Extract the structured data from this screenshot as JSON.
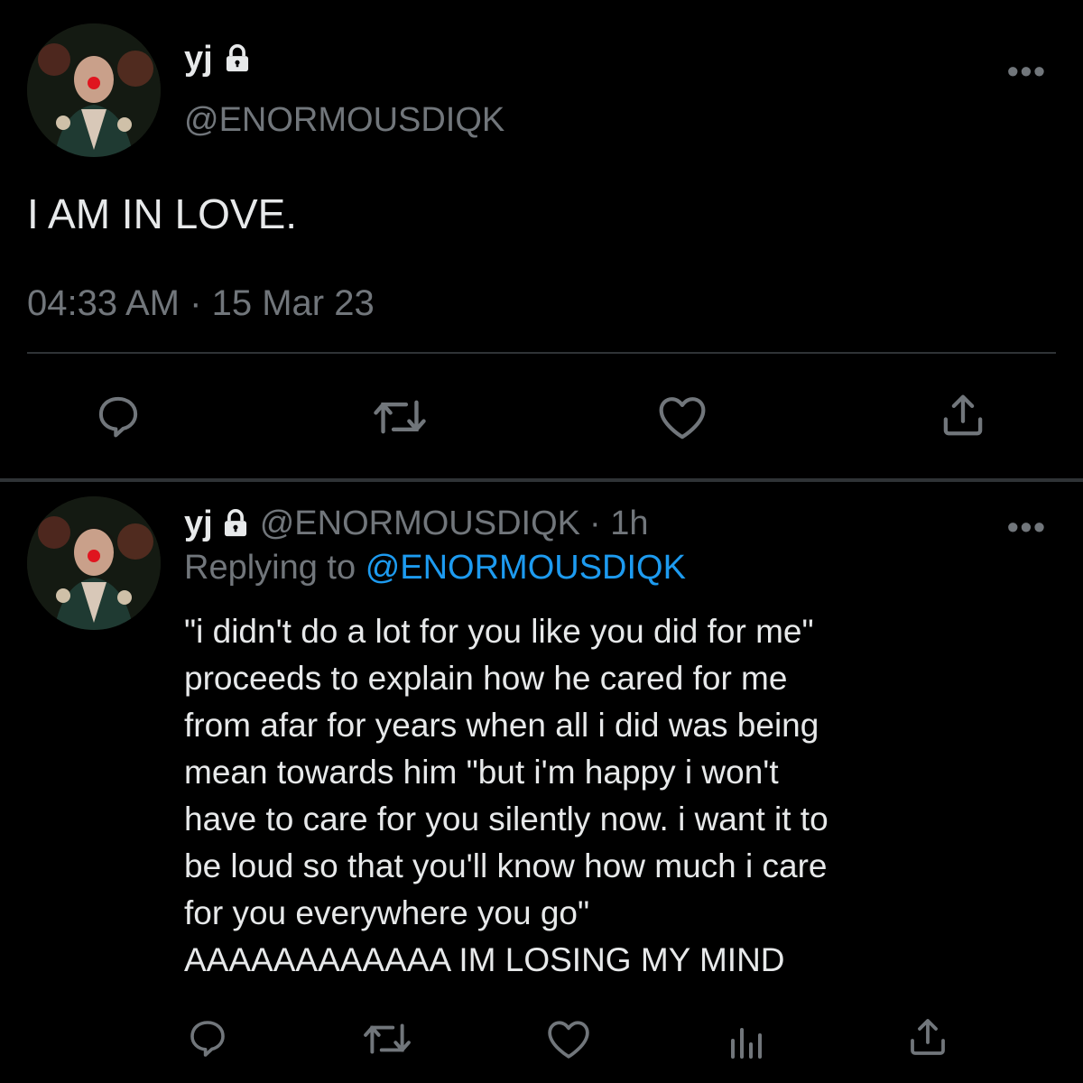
{
  "tweet": {
    "author_name": "yj",
    "handle": "@ENORMOUSDIQK",
    "text": "I AM IN LOVE.",
    "time": "04:33 AM",
    "separator": "·",
    "date": "15 Mar 23",
    "more": "•••",
    "icons": [
      "reply-icon",
      "retweet-icon",
      "like-icon",
      "share-icon"
    ]
  },
  "reply": {
    "author_name": "yj",
    "handle": "@ENORMOUSDIQK",
    "age": "· 1h",
    "replying_label": "Replying to",
    "replying_to": "@ENORMOUSDIQK",
    "text": "\"i didn't do a lot for you like you did for me\"\nproceeds to explain how he cared for me\nfrom afar for years when all i did was being\nmean towards him \"but i'm happy i won't\nhave to care for you silently now. i want it to\nbe loud so that you'll know how much i care\nfor you everywhere you go\"\nAAAAAAAAAAAA IM LOSING MY MIND",
    "more": "•••",
    "icons": [
      "reply-icon",
      "retweet-icon",
      "like-icon",
      "analytics-icon",
      "share-icon"
    ]
  },
  "colors": {
    "background": "#000000",
    "text": "#e7e9ea",
    "muted": "#71767b",
    "link": "#1d9bf0",
    "divider": "#2f3336"
  }
}
